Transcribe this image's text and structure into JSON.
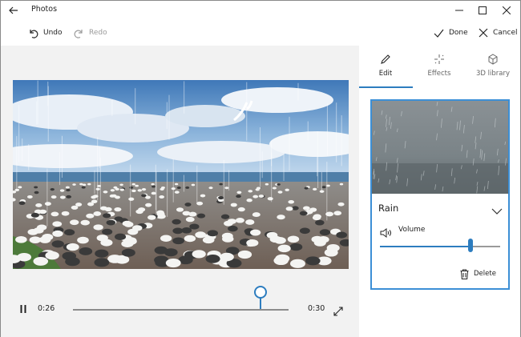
{
  "window": {
    "title": "Photos"
  },
  "icons": {
    "back": "back-arrow-icon",
    "minimize": "minimize-icon",
    "maximize": "maximize-icon",
    "close": "close-icon",
    "undo": "undo-icon",
    "redo": "redo-icon",
    "done": "checkmark-icon",
    "cancel": "x-icon",
    "pause": "pause-icon",
    "expand": "expand-icon",
    "edit": "pencil-icon",
    "effects": "sparkle-icon",
    "library": "cube-icon",
    "chevron": "chevron-down-icon",
    "volume": "speaker-icon",
    "delete": "trash-icon"
  },
  "toolbar": {
    "undo_label": "Undo",
    "redo_label": "Redo",
    "done_label": "Done",
    "cancel_label": "Cancel"
  },
  "player": {
    "current_time": "0:26",
    "total_time": "0:30",
    "progress": 0.87
  },
  "panel": {
    "tabs": [
      {
        "label": "Edit",
        "active": true
      },
      {
        "label": "Effects",
        "active": false
      },
      {
        "label": "3D library",
        "active": false
      }
    ],
    "effect": {
      "name": "Rain",
      "volume_label": "Volume",
      "volume_level": 0.75,
      "delete_label": "Delete"
    }
  },
  "colors": {
    "accent": "#2d7dbf",
    "card_border": "#3c8fd6"
  }
}
